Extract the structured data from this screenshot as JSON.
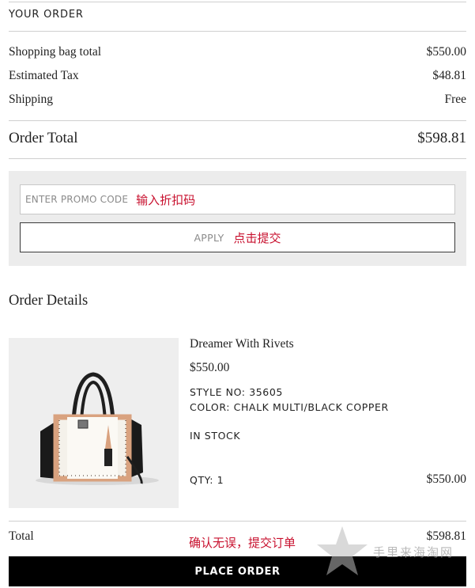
{
  "order_summary": {
    "heading": "YOUR ORDER",
    "rows": [
      {
        "label": "Shopping bag total",
        "value": "$550.00"
      },
      {
        "label": "Estimated Tax",
        "value": "$48.81"
      },
      {
        "label": "Shipping",
        "value": "Free"
      }
    ],
    "total_label": "Order Total",
    "total_value": "$598.81"
  },
  "promo": {
    "placeholder": "ENTER PROMO CODE",
    "placeholder_annotation": "输入折扣码",
    "apply_label": "APPLY",
    "apply_annotation": "点击提交"
  },
  "order_details": {
    "title": "Order Details",
    "item": {
      "name": "Dreamer With Rivets",
      "price": "$550.00",
      "style": "STYLE NO: 35605",
      "color": "COLOR: CHALK MULTI/BLACK COPPER",
      "stock": "IN STOCK",
      "qty": "QTY: 1",
      "line_total": "$550.00"
    }
  },
  "footer": {
    "total_label": "Total",
    "total_value": "$598.81",
    "annotation": "确认无误，提交订单",
    "place_order_label": "PLACE ORDER"
  },
  "watermark": {
    "text": "手里来海淘网"
  },
  "colors": {
    "annotation_red": "#c8102e",
    "place_order_bg": "#000000",
    "promo_panel_bg": "#ececec"
  }
}
